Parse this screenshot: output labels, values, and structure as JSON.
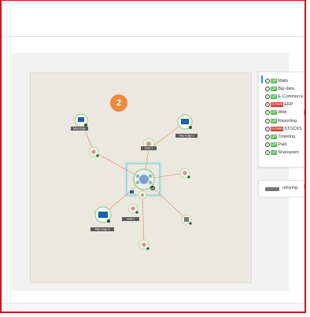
{
  "canvas_badge": "2",
  "side_badge": "1",
  "services": [
    {
      "status": "UP",
      "name": "Mails"
    },
    {
      "status": "UP",
      "name": "Big-data"
    },
    {
      "status": "UP",
      "name": "E-Commerce"
    },
    {
      "status": "DOWN",
      "name": "ERP"
    },
    {
      "status": "UP",
      "name": "Web"
    },
    {
      "status": "UP",
      "name": "Reporting"
    },
    {
      "status": "DOWN",
      "name": "STOCKS"
    },
    {
      "status": "UP",
      "name": "Ticketing"
    },
    {
      "status": "UP",
      "name": "Paid"
    },
    {
      "status": "UP",
      "name": "Sharepoint"
    }
  ],
  "device": {
    "label": "relsying"
  },
  "map_labels": {
    "top_left": "Map Edge",
    "top_right": "Map Edge 3",
    "center": "Host 1",
    "bottom_left": "Map Edge 3",
    "bottom_mid": "Host 2"
  },
  "colors": {
    "accent": "#ee8a3b",
    "up": "#5cb85c",
    "down": "#d9362e",
    "frame": "#d0121b",
    "link": "#e0875a",
    "selection": "#33c6d6"
  }
}
